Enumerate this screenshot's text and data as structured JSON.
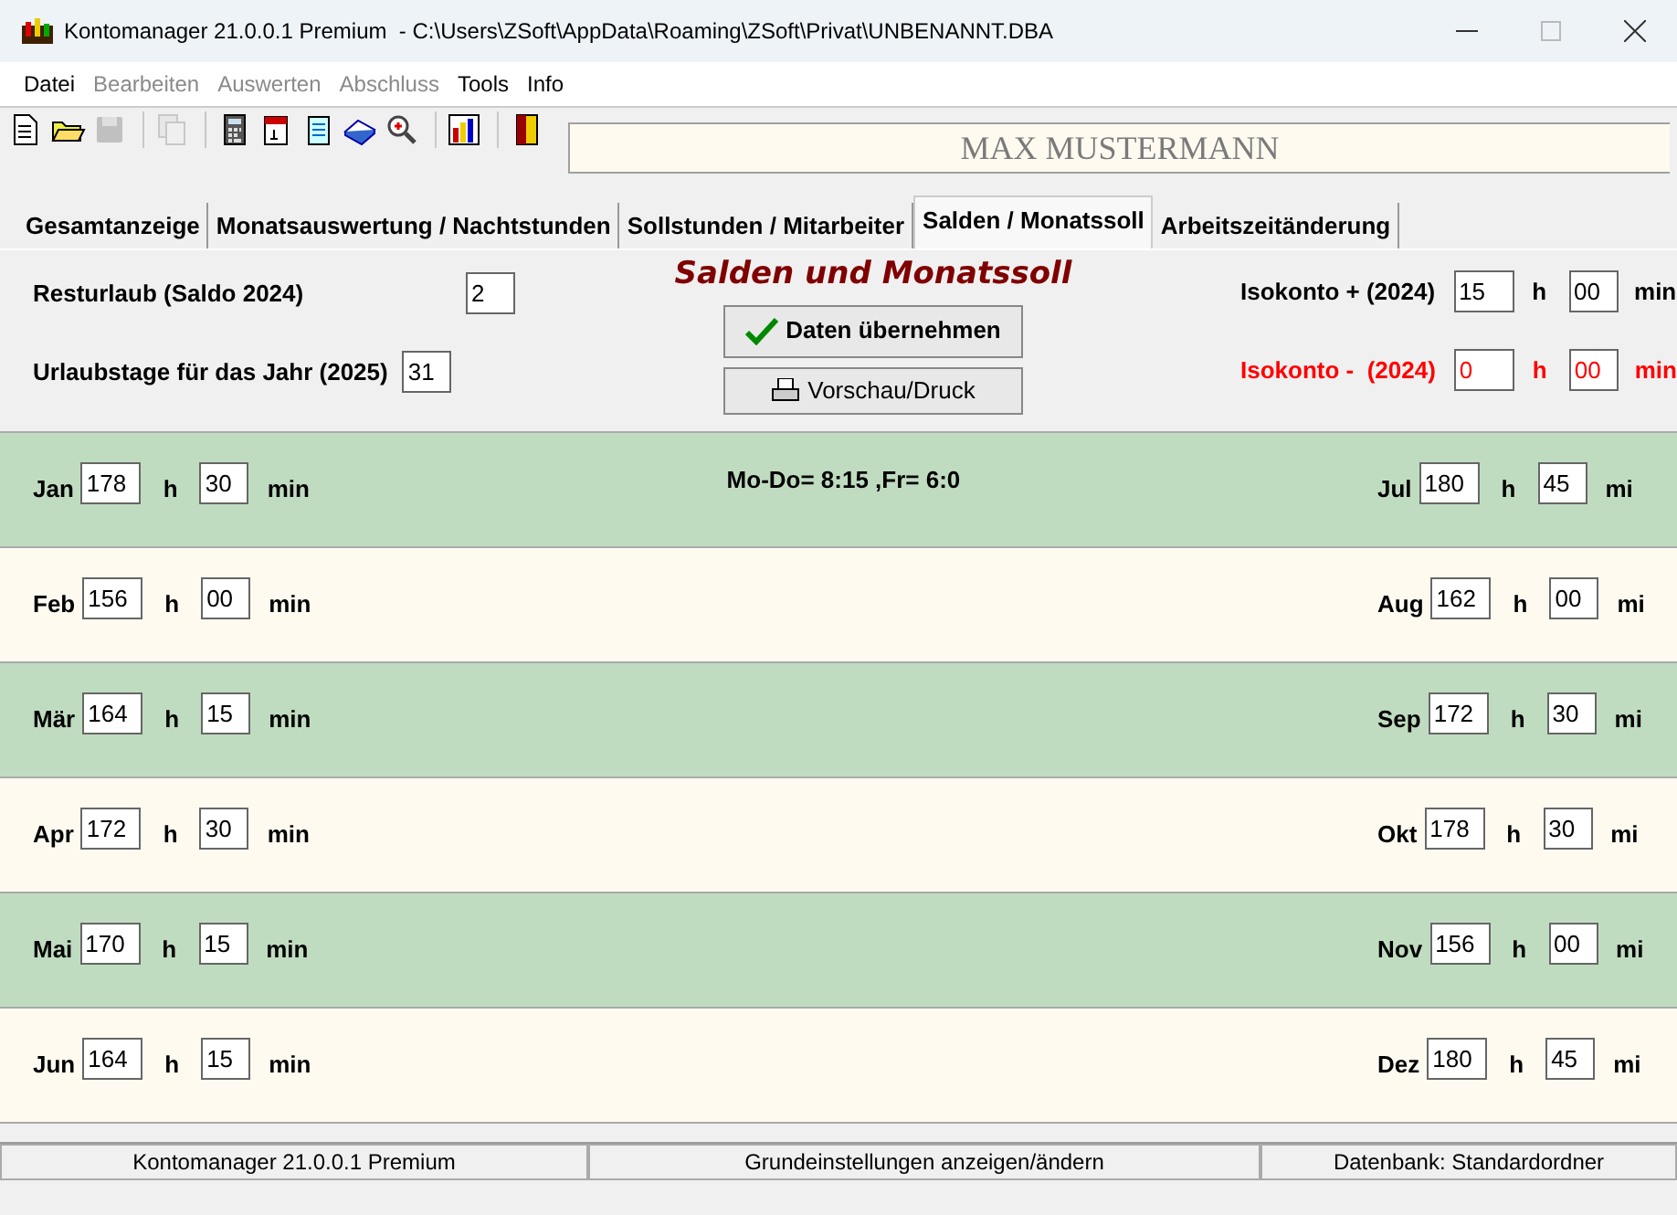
{
  "window": {
    "title": "Kontomanager 21.0.0.1 Premium  - C:\\Users\\ZSoft\\AppData\\Roaming\\ZSoft\\Privat\\UNBENANNT.DBA"
  },
  "menu": [
    {
      "label": "Datei",
      "disabled": false
    },
    {
      "label": "Bearbeiten",
      "disabled": true
    },
    {
      "label": "Auswerten",
      "disabled": true
    },
    {
      "label": "Abschluss",
      "disabled": true
    },
    {
      "label": "Tools",
      "disabled": false
    },
    {
      "label": "Info",
      "disabled": false
    }
  ],
  "toolbar": [
    {
      "kind": "new",
      "disabled": false
    },
    {
      "kind": "open",
      "disabled": false
    },
    {
      "kind": "save",
      "disabled": true
    },
    {
      "kind": "sep"
    },
    {
      "kind": "copy",
      "disabled": true
    },
    {
      "kind": "sep"
    },
    {
      "kind": "calculator",
      "disabled": false
    },
    {
      "kind": "calendar",
      "disabled": false
    },
    {
      "kind": "notepad",
      "disabled": false
    },
    {
      "kind": "book",
      "disabled": false
    },
    {
      "kind": "zoom",
      "disabled": false
    },
    {
      "kind": "sep"
    },
    {
      "kind": "chart",
      "disabled": false
    },
    {
      "kind": "sep"
    },
    {
      "kind": "exit",
      "disabled": false
    }
  ],
  "user_name": "MAX MUSTERMANN",
  "tabs": [
    {
      "label": "Gesamtanzeige",
      "selected": false
    },
    {
      "label": "Monatsauswertung / Nachtstunden",
      "selected": false
    },
    {
      "label": "Sollstunden / Mitarbeiter",
      "selected": false
    },
    {
      "label": "Salden / Monatssoll",
      "selected": true
    },
    {
      "label": "Arbeitszeitänderung",
      "selected": false
    }
  ],
  "panel": {
    "heading": "Salden und Monatssoll",
    "fields": [
      {
        "label": "Resturlaub (Saldo 2024)",
        "value": "2"
      },
      {
        "label": "Urlaubstage für das Jahr (2025)",
        "value": "31"
      }
    ],
    "buttons": [
      {
        "label": "Daten übernehmen",
        "kind": "apply"
      },
      {
        "label": "Vorschau/Druck",
        "kind": "print"
      }
    ],
    "isokonto": [
      {
        "label": "Isokonto + (2024)",
        "hours": "15",
        "h_unit": "h",
        "minutes": "00",
        "min_unit": "min",
        "negative": false
      },
      {
        "label": "Isokonto -  (2024)",
        "hours": "0",
        "h_unit": "h",
        "minutes": "00",
        "min_unit": "min",
        "negative": true
      }
    ]
  },
  "schedule_note": "Mo-Do= 8:15 ,Fr= 6:0",
  "months": [
    {
      "color": "#c0dcc0",
      "left": {
        "month": "Jan",
        "hours": "178",
        "h_unit": "h",
        "minutes": "30",
        "min_unit": "min"
      },
      "right": {
        "month": "Jul",
        "hours": "180",
        "h_unit": "h",
        "minutes": "45",
        "min_unit": "mi"
      }
    },
    {
      "color": "#fffaf0",
      "left": {
        "month": "Feb",
        "hours": "156",
        "h_unit": "h",
        "minutes": "00",
        "min_unit": "min"
      },
      "right": {
        "month": "Aug",
        "hours": "162",
        "h_unit": "h",
        "minutes": "00",
        "min_unit": "mi"
      }
    },
    {
      "color": "#c0dcc0",
      "left": {
        "month": "Mär",
        "hours": "164",
        "h_unit": "h",
        "minutes": "15",
        "min_unit": "min"
      },
      "right": {
        "month": "Sep",
        "hours": "172",
        "h_unit": "h",
        "minutes": "30",
        "min_unit": "mi"
      }
    },
    {
      "color": "#fffaf0",
      "left": {
        "month": "Apr",
        "hours": "172",
        "h_unit": "h",
        "minutes": "30",
        "min_unit": "min"
      },
      "right": {
        "month": "Okt",
        "hours": "178",
        "h_unit": "h",
        "minutes": "30",
        "min_unit": "mi"
      }
    },
    {
      "color": "#c0dcc0",
      "left": {
        "month": "Mai",
        "hours": "170",
        "h_unit": "h",
        "minutes": "15",
        "min_unit": "min"
      },
      "right": {
        "month": "Nov",
        "hours": "156",
        "h_unit": "h",
        "minutes": "00",
        "min_unit": "mi"
      }
    },
    {
      "color": "#fffaf0",
      "left": {
        "month": "Jun",
        "hours": "164",
        "h_unit": "h",
        "minutes": "15",
        "min_unit": "min"
      },
      "right": {
        "month": "Dez",
        "hours": "180",
        "h_unit": "h",
        "minutes": "45",
        "min_unit": "mi"
      }
    }
  ],
  "status_bar": [
    "Kontomanager 21.0.0.1 Premium",
    "Grundeinstellungen anzeigen/ändern",
    "Datenbank: Standardordner"
  ]
}
